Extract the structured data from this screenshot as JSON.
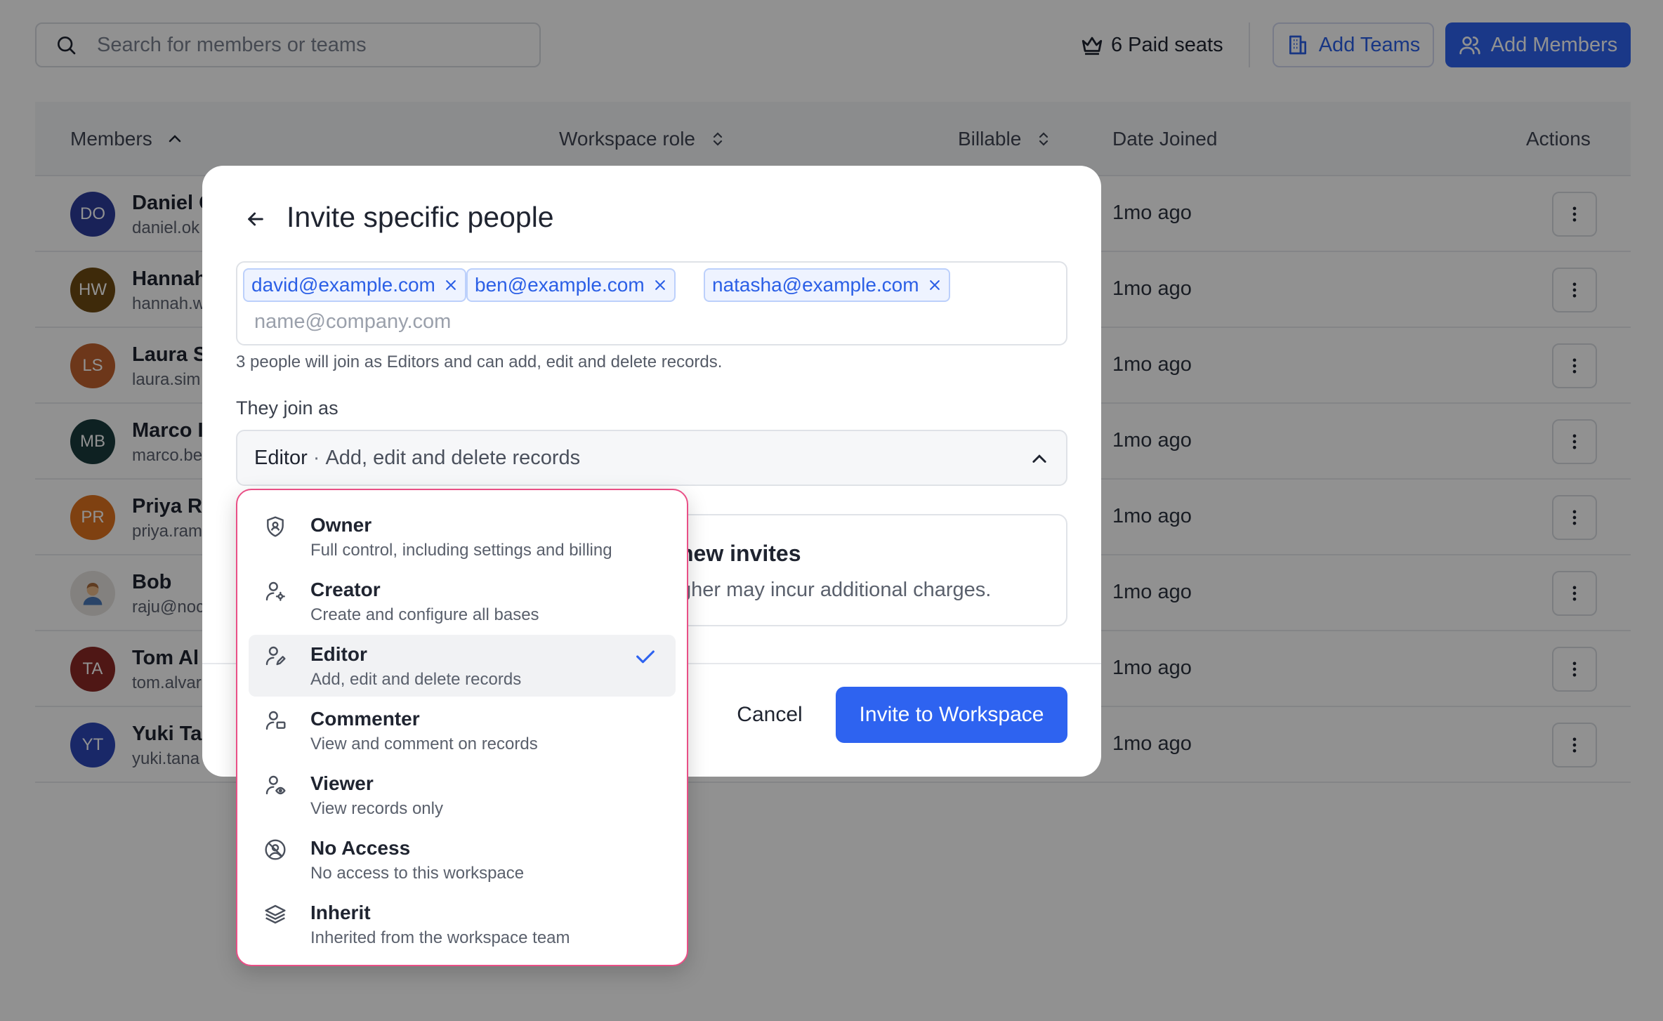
{
  "colors": {
    "accent": "#2e63f0",
    "focus_border": "#e94f86",
    "selected_row": "#f1f2f4"
  },
  "toolbar": {
    "search_placeholder": "Search for members or teams",
    "paid_seats": "6 Paid seats",
    "add_teams": "Add Teams",
    "add_members": "Add Members"
  },
  "table": {
    "headers": {
      "members": "Members",
      "role": "Workspace role",
      "billable": "Billable",
      "date": "Date Joined",
      "actions": "Actions"
    },
    "rows": [
      {
        "initials": "DO",
        "name": "Daniel O",
        "email": "daniel.ok",
        "date": "1mo ago",
        "color": "#2c3d9c"
      },
      {
        "initials": "HW",
        "name": "Hannah",
        "email": "hannah.w",
        "date": "1mo ago",
        "color": "#6e4a12"
      },
      {
        "initials": "LS",
        "name": "Laura S",
        "email": "laura.sim",
        "date": "1mo ago",
        "color": "#c0612e"
      },
      {
        "initials": "MB",
        "name": "Marco I",
        "email": "marco.be",
        "date": "1mo ago",
        "color": "#1a3a3d"
      },
      {
        "initials": "PR",
        "name": "Priya Ra",
        "email": "priya.ram",
        "date": "1mo ago",
        "color": "#e0731f"
      },
      {
        "initials": "",
        "name": "Bob",
        "email": "raju@noc",
        "date": "1mo ago",
        "color": "#e6e3df"
      },
      {
        "initials": "TA",
        "name": "Tom Al",
        "email": "tom.alvar",
        "date": "1mo ago",
        "color": "#8c2a26"
      },
      {
        "initials": "YT",
        "name": "Yuki Ta",
        "email": "yuki.tana",
        "date": "1mo ago",
        "color": "#2d47b8"
      }
    ]
  },
  "modal": {
    "title": "Invite specific people",
    "chips": [
      "david@example.com",
      "ben@example.com",
      "natasha@example.com"
    ],
    "email_placeholder": "name@company.com",
    "helper": "3 people will join as Editors and can add, edit and delete records.",
    "join_label": "They join as",
    "selected_role": "Editor",
    "selected_separator": "·",
    "selected_desc": "Add, edit and delete records",
    "notice_title": "new invites",
    "notice_text": "gher may incur additional charges.",
    "cancel": "Cancel",
    "invite": "Invite to Workspace"
  },
  "dropdown": {
    "options": [
      {
        "title": "Owner",
        "desc": "Full control, including settings and billing",
        "icon": "shield-user-icon"
      },
      {
        "title": "Creator",
        "desc": "Create and configure all bases",
        "icon": "user-gear-icon"
      },
      {
        "title": "Editor",
        "desc": "Add, edit and delete records",
        "icon": "user-pencil-icon",
        "selected": true
      },
      {
        "title": "Commenter",
        "desc": "View and comment on records",
        "icon": "user-comment-icon"
      },
      {
        "title": "Viewer",
        "desc": "View records only",
        "icon": "user-eye-icon"
      },
      {
        "title": "No Access",
        "desc": "No access to this workspace",
        "icon": "no-access-icon"
      },
      {
        "title": "Inherit",
        "desc": "Inherited from the workspace team",
        "icon": "layers-icon"
      }
    ]
  }
}
